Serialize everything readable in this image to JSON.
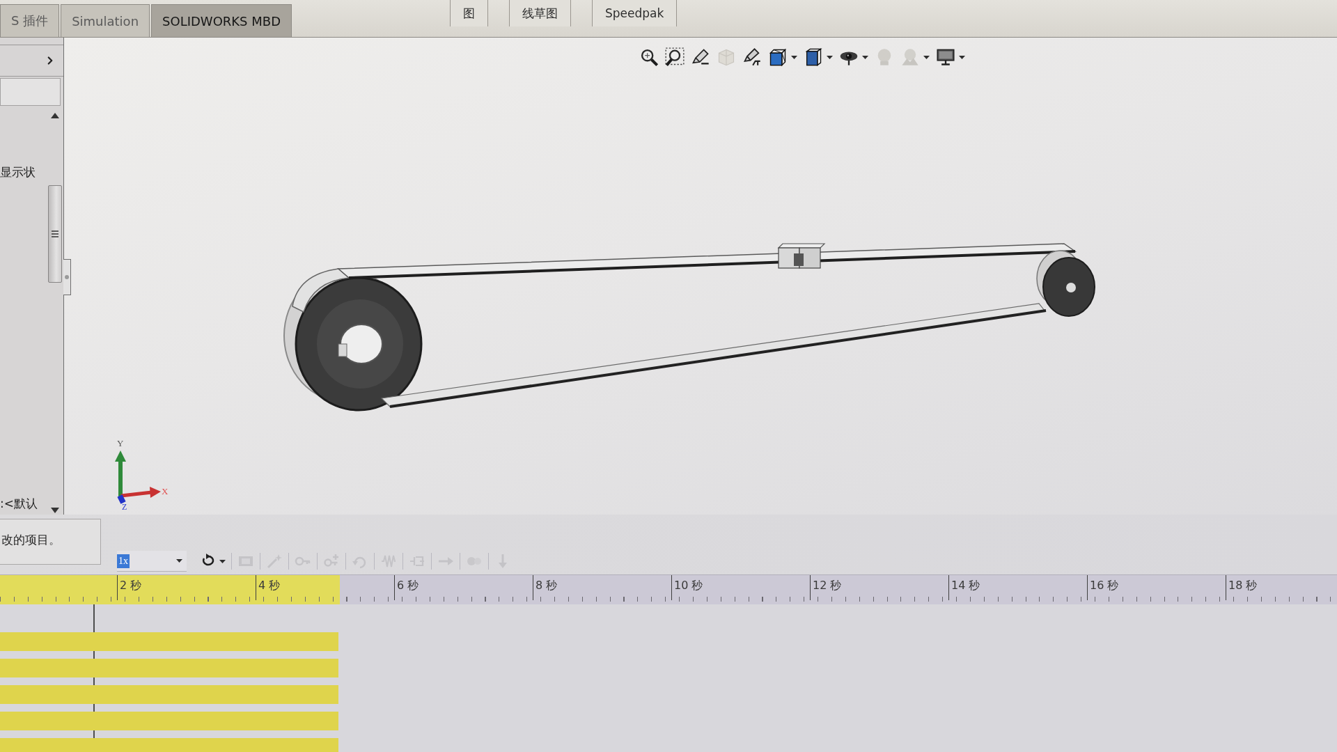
{
  "tabs": [
    {
      "label": "S 插件",
      "selected": false
    },
    {
      "label": "Simulation",
      "selected": false
    },
    {
      "label": "SOLIDWORKS MBD",
      "selected": true
    }
  ],
  "ribbon": [
    {
      "label": "图"
    },
    {
      "label": "线草图"
    },
    {
      "label": "Speedpak"
    }
  ],
  "side_panel": {
    "top_text": "显示状",
    "bottom_text": ":<默认"
  },
  "status_message": "改的项目。",
  "view_toolbar": [
    {
      "kind": "zoom-fit",
      "disabled": false
    },
    {
      "kind": "zoom-area",
      "disabled": false
    },
    {
      "kind": "previous-view",
      "disabled": false
    },
    {
      "kind": "section-view",
      "disabled": true
    },
    {
      "kind": "annotation-view",
      "disabled": false
    },
    {
      "kind": "view-orientation",
      "disabled": false,
      "dropdown": true
    },
    {
      "kind": "display-style",
      "disabled": false,
      "dropdown": true
    },
    {
      "kind": "hide-show",
      "disabled": false,
      "dropdown": true
    },
    {
      "kind": "edit-appearance",
      "disabled": true
    },
    {
      "kind": "apply-scene",
      "disabled": true,
      "dropdown": true
    },
    {
      "kind": "view-settings",
      "disabled": false,
      "dropdown": true
    }
  ],
  "triad": {
    "x_label": "X",
    "y_label": "Y",
    "z_label": "Z"
  },
  "motion_toolbar": {
    "speed": {
      "value": "1x",
      "selected": true
    },
    "tools": [
      {
        "kind": "loop",
        "disabled": false,
        "dropdown": true
      },
      {
        "kind": "save",
        "disabled": true
      },
      {
        "kind": "wizard",
        "disabled": true
      },
      {
        "kind": "autokey",
        "disabled": true
      },
      {
        "kind": "add-key",
        "disabled": true
      },
      {
        "kind": "motor",
        "disabled": true
      },
      {
        "kind": "spring",
        "disabled": true
      },
      {
        "kind": "damper",
        "disabled": true
      },
      {
        "kind": "force",
        "disabled": true
      },
      {
        "kind": "contact",
        "disabled": true
      },
      {
        "kind": "gravity",
        "disabled": true
      }
    ]
  },
  "timeline": {
    "level": 0.254,
    "ticks": [
      "2 秒",
      "4 秒",
      "6 秒",
      "8 秒",
      "10 秒",
      "12 秒",
      "14 秒",
      "16 秒",
      "18 秒"
    ],
    "tracks": [
      {
        "level": 0.253
      },
      {
        "level": 0.253
      },
      {
        "level": 0.253
      },
      {
        "level": 0.253
      },
      {
        "level": 0.253
      }
    ]
  }
}
